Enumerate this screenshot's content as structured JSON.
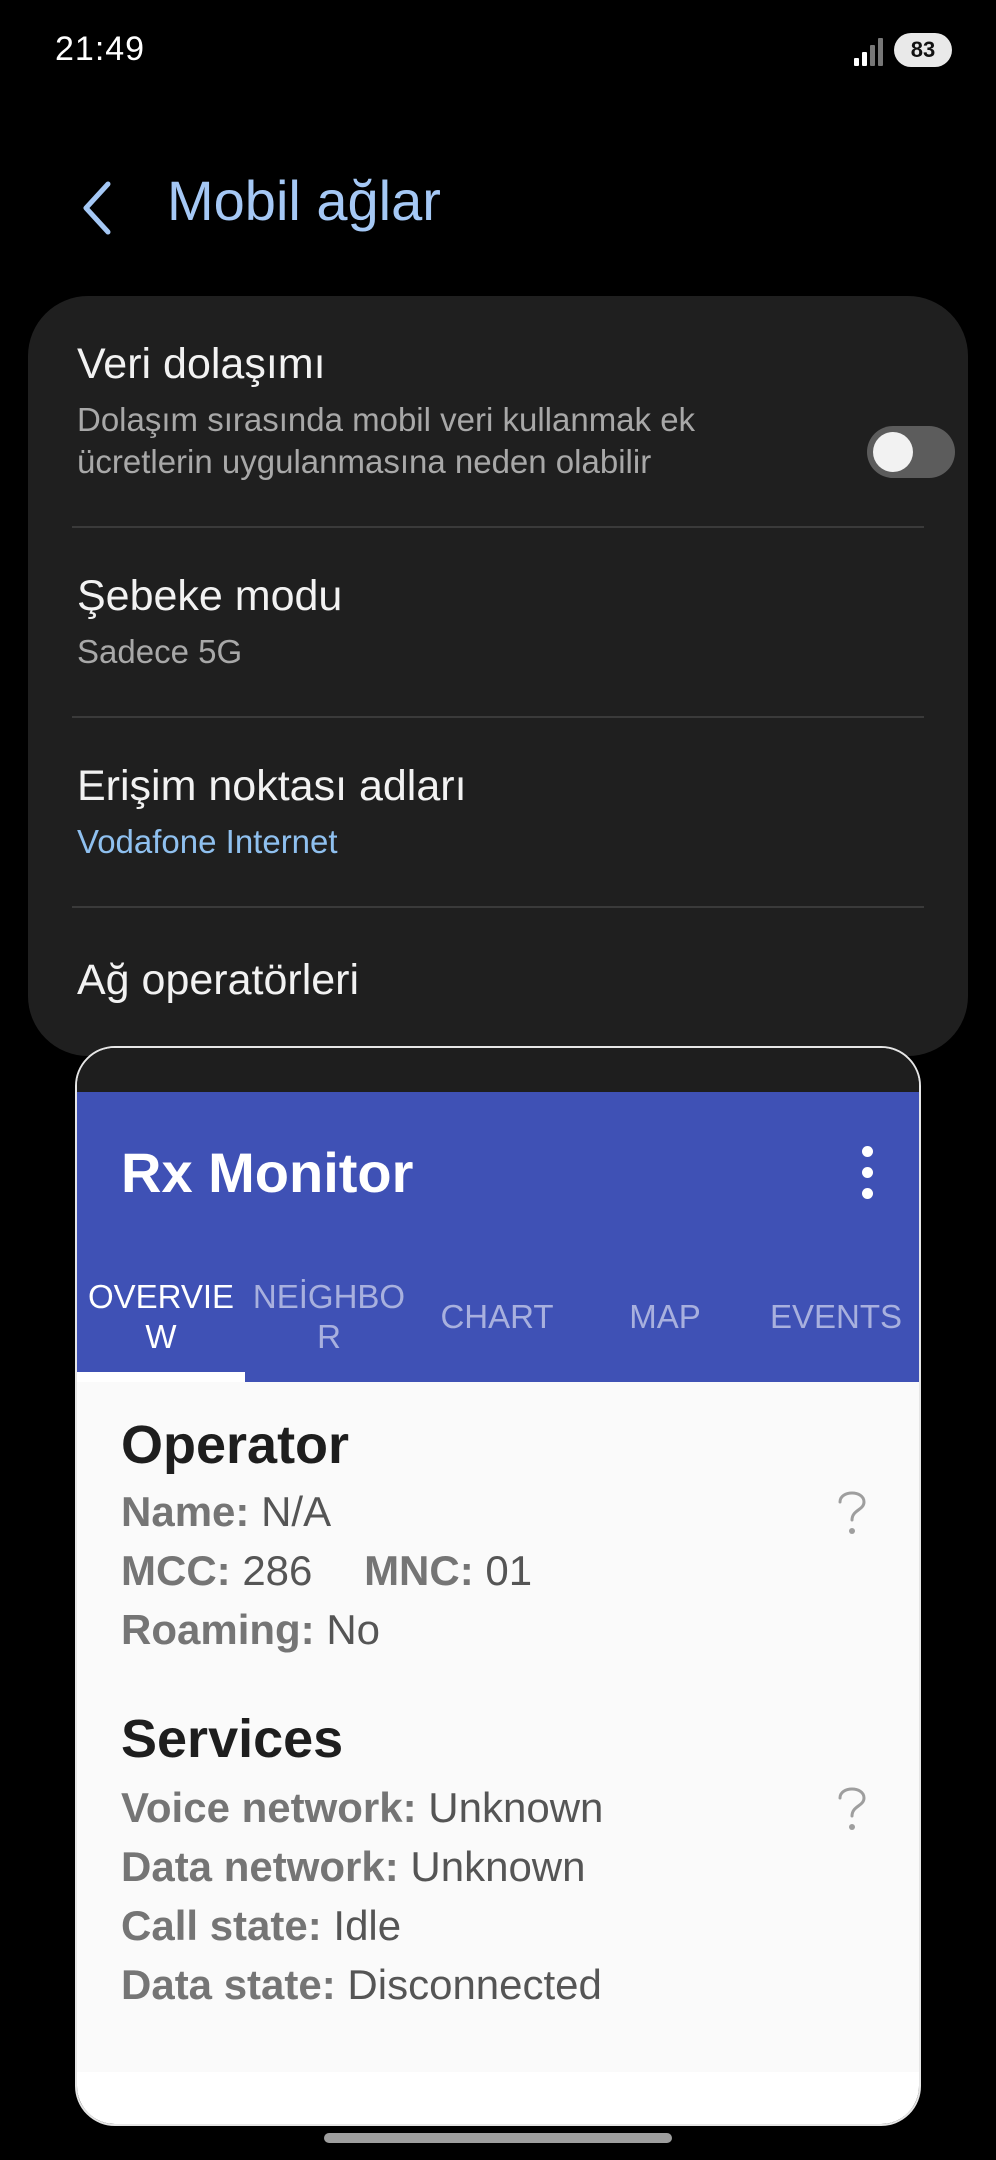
{
  "status_bar": {
    "time": "21:49",
    "battery": "83",
    "icons": [
      "signal-icon",
      "battery-icon"
    ]
  },
  "header": {
    "title": "Mobil ağlar",
    "back_icon": "back-arrow-icon"
  },
  "settings": {
    "data_roaming": {
      "title": "Veri dolaşımı",
      "subtitle": "Dolaşım sırasında mobil veri kullanmak ek ücretlerin uygulanmasına neden olabilir",
      "enabled": false
    },
    "network_mode": {
      "title": "Şebeke modu",
      "subtitle": "Sadece 5G"
    },
    "access_point_names": {
      "title": "Erişim noktası adları",
      "subtitle": "Vodafone Internet"
    },
    "network_operators": {
      "title": "Ağ operatörleri"
    }
  },
  "rx_monitor": {
    "title": "Rx Monitor",
    "menu_icon": "more-vert-icon",
    "tabs": [
      {
        "label": "OVERVIE\nW",
        "active": true
      },
      {
        "label": "NEİGHBO\nR",
        "active": false
      },
      {
        "label": "CHART",
        "active": false
      },
      {
        "label": "MAP",
        "active": false
      },
      {
        "label": "EVENTS",
        "active": false
      }
    ],
    "operator": {
      "title": "Operator",
      "name_label": "Name:",
      "name_value": "N/A",
      "mcc_label": "MCC:",
      "mcc_value": "286",
      "mnc_label": "MNC:",
      "mnc_value": "01",
      "roaming_label": "Roaming:",
      "roaming_value": "No"
    },
    "services": {
      "title": "Services",
      "voice_label": "Voice network:",
      "voice_value": "Unknown",
      "data_label": "Data network:",
      "data_value": "Unknown",
      "call_label": "Call state:",
      "call_value": "Idle",
      "data_state_label": "Data state:",
      "data_state_value": "Disconnected"
    },
    "help_icon": "help-question-icon"
  },
  "colors": {
    "accent_title": "#a5c8f5",
    "accent_link": "#8fc0ef",
    "appbar": "#3f51b5",
    "card_bg": "#1f1f1f"
  }
}
